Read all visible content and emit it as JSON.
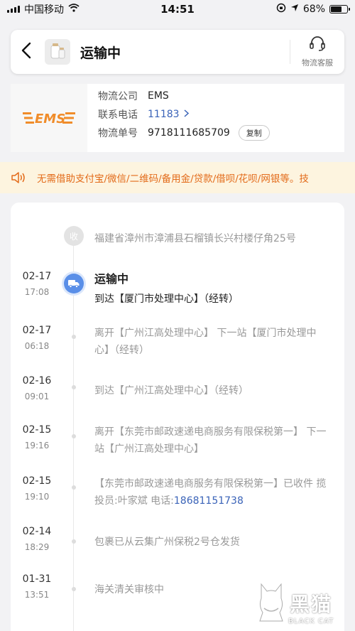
{
  "status_bar": {
    "carrier": "中国移动",
    "time": "14:51",
    "battery": "68%"
  },
  "header": {
    "title": "运输中",
    "service_label": "物流客服",
    "icons": {
      "back": "chevron-left-icon",
      "service": "headset-icon"
    }
  },
  "carrier": {
    "logo_text": "EMS",
    "rows": [
      {
        "key": "物流公司",
        "value": "EMS"
      },
      {
        "key": "联系电话",
        "value": "11183"
      },
      {
        "key": "物流单号",
        "value": "9718111685709"
      }
    ],
    "copy_label": "复制"
  },
  "notice": {
    "text": "无需借助支付宝/微信/二维码/备用金/贷款/借呗/花呗/网银等。技",
    "icon": "speaker-icon"
  },
  "timeline": {
    "receiver_badge": "收",
    "receiver_address": "福建省漳州市漳浦县石榴镇长兴村楼仔角25号",
    "current": {
      "date": "02-17",
      "time": "17:08",
      "status": "运输中",
      "text": "到达【厦门市处理中心】（经转）"
    },
    "events": [
      {
        "date": "02-17",
        "time": "06:18",
        "text": "离开【广州江高处理中心】 下一站【厦门市处理中心】（经转）"
      },
      {
        "date": "02-16",
        "time": "09:01",
        "text": "到达【广州江高处理中心】（经转）"
      },
      {
        "date": "02-15",
        "time": "19:16",
        "text": "离开【东莞市邮政速递电商服务有限保税第一】 下一站【广州江高处理中心】"
      },
      {
        "date": "02-15",
        "time": "19:10",
        "text": "【东莞市邮政速递电商服务有限保税第一】已收件 揽投员:叶家斌 电话:",
        "phone": "18681151738"
      },
      {
        "date": "02-14",
        "time": "18:29",
        "text": "包裹已从云集广州保税2号仓发货"
      },
      {
        "date": "01-31",
        "time": "13:51",
        "text": "海关清关审核中"
      }
    ]
  },
  "watermark": {
    "cn": "黑猫",
    "en": "BLACK CAT"
  },
  "colors": {
    "accent_blue": "#5a8fe8",
    "link_blue": "#3a63b8",
    "notice_bg": "#fdf4df",
    "notice_text": "#e36b1a",
    "ems_orange": "#f08c2a"
  }
}
